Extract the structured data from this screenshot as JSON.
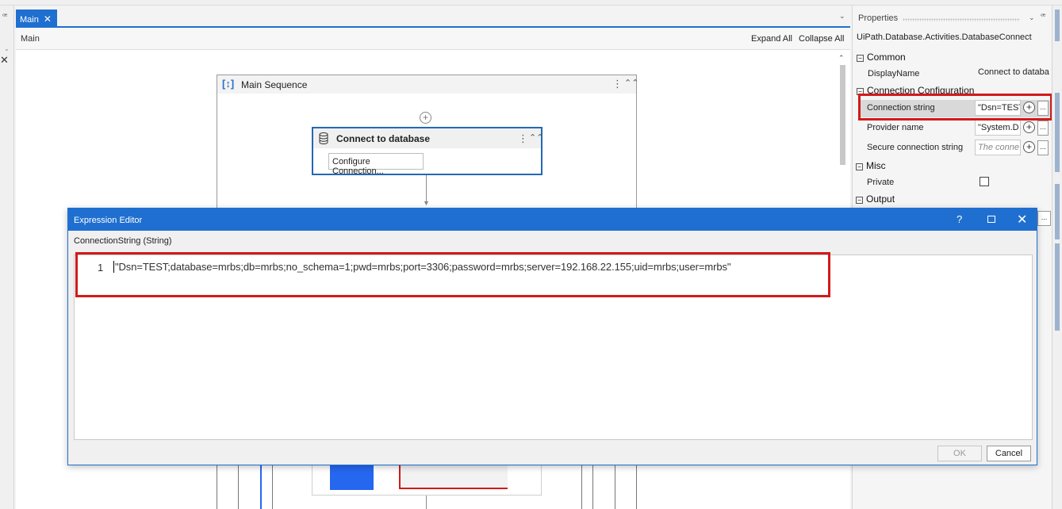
{
  "designer": {
    "tab_label": "Main",
    "tab_close": "✕",
    "breadcrumb": "Main",
    "expand_all": "Expand All",
    "collapse_all": "Collapse All",
    "sequence_title": "Main Sequence",
    "activity_title": "Connect to database",
    "configure_label": "Configure Connection..."
  },
  "properties": {
    "title": "Properties",
    "activity_type": "UiPath.Database.Activities.DatabaseConnect",
    "categories": {
      "common": "Common",
      "connection": "Connection Configuration",
      "misc": "Misc",
      "output": "Output"
    },
    "expander_symbol": "−",
    "rows": {
      "display_name": {
        "label": "DisplayName",
        "value": "Connect to databa"
      },
      "connection_string": {
        "label": "Connection string",
        "value": "\"Dsn=TEST"
      },
      "provider_name": {
        "label": "Provider name",
        "value": "\"System.D"
      },
      "secure_connection": {
        "label": "Secure connection string",
        "placeholder": "The conne"
      },
      "private": {
        "label": "Private"
      }
    }
  },
  "dialog": {
    "title": "Expression Editor",
    "help": "?",
    "close": "✕",
    "subtitle": "ConnectionString (String)",
    "line_number": "1",
    "code": "\"Dsn=TEST;database=mrbs;db=mrbs;no_schema=1;pwd=mrbs;port=3306;password=mrbs;server=192.168.22.155;uid=mrbs;user=mrbs\"",
    "ok_label": "OK",
    "cancel_label": "Cancel"
  },
  "icons": {
    "plus": "+",
    "ellipsis": "...",
    "kebab": "⋮",
    "collapse": "⌃",
    "chevron_down": "⌄",
    "pin": "ꟹ"
  },
  "colors": {
    "accent_blue": "#1f6fd0",
    "highlight_red": "#d21a1a"
  }
}
